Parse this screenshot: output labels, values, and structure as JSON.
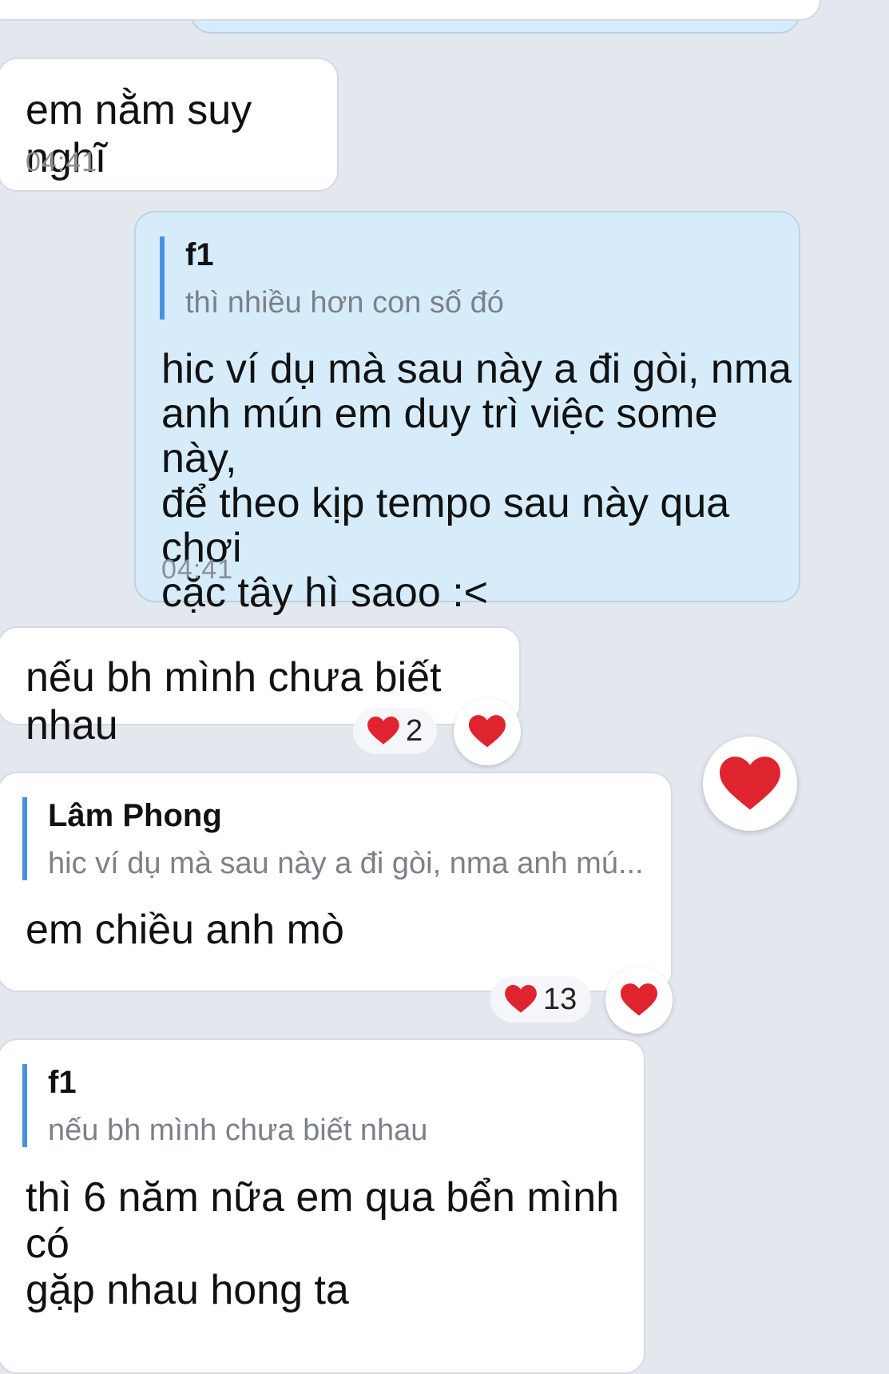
{
  "messages": [
    {
      "text": "em nằm suy nghĩ",
      "time": "04:41",
      "side": "in"
    },
    {
      "side": "out",
      "quote": {
        "name": "f1",
        "text": "thì nhiều hơn con số đó"
      },
      "lines": [
        "hic ví dụ mà sau này a đi gòi, nma",
        "anh mún em duy trì việc some này,",
        "để theo kịp tempo sau này qua chơi",
        "cặc tây hì saoo :<"
      ],
      "time": "04:41"
    },
    {
      "text": "nếu bh mình chưa biết nhau",
      "side": "in",
      "reaction_count": "2"
    },
    {
      "side": "in",
      "quote": {
        "name": "Lâm Phong",
        "text": "hic ví dụ mà sau này a đi gòi, nma anh mú..."
      },
      "text": "em chiều anh mò",
      "reaction_count": "13"
    },
    {
      "side": "in",
      "quote": {
        "name": "f1",
        "text": "nếu bh mình chưa biết nhau"
      },
      "lines": [
        "thì 6 năm nữa em qua bển mình có",
        "gặp nhau hong ta"
      ]
    }
  ],
  "colors": {
    "background": "#e3e8ef",
    "outgoing": "#d7ecfb",
    "incoming": "#ffffff",
    "accent": "#4a90e2",
    "heart": "#e0242f"
  },
  "icons": {
    "reaction": "heart-icon"
  }
}
